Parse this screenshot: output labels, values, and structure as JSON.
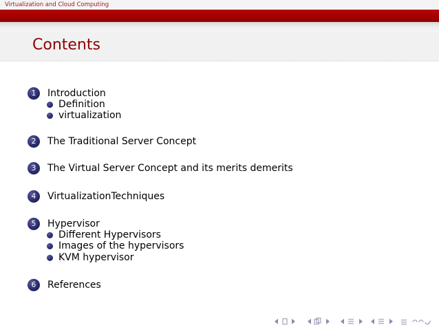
{
  "header": {
    "short_title": "Virtualization and Cloud Computing"
  },
  "frame": {
    "title": "Contents"
  },
  "toc": {
    "sections": [
      {
        "number": "1",
        "label": "Introduction",
        "subsections": [
          "Definition",
          "virtualization"
        ]
      },
      {
        "number": "2",
        "label": "The Traditional Server Concept",
        "subsections": []
      },
      {
        "number": "3",
        "label": "The Virtual Server Concept and its merits demerits",
        "subsections": []
      },
      {
        "number": "4",
        "label": "VirtualizationTechniques",
        "subsections": []
      },
      {
        "number": "5",
        "label": "Hypervisor",
        "subsections": [
          "Different Hypervisors",
          "Images of the hypervisors",
          "KVM hypervisor"
        ]
      },
      {
        "number": "6",
        "label": "References",
        "subsections": []
      }
    ]
  },
  "navigation": {
    "icons": [
      "first-slide-icon",
      "previous-slide-icon",
      "slide-frame-icon",
      "next-slide-icon",
      "previous-subsection-icon",
      "subsection-icon",
      "next-subsection-icon",
      "previous-section-icon",
      "section-icon",
      "next-section-icon",
      "align-icon",
      "search-back-icon",
      "search-icon",
      "search-forward-icon"
    ],
    "color": "#8c8cb0"
  },
  "theme": {
    "accent": "#8f0000",
    "bullet": "#2b2b6f"
  }
}
